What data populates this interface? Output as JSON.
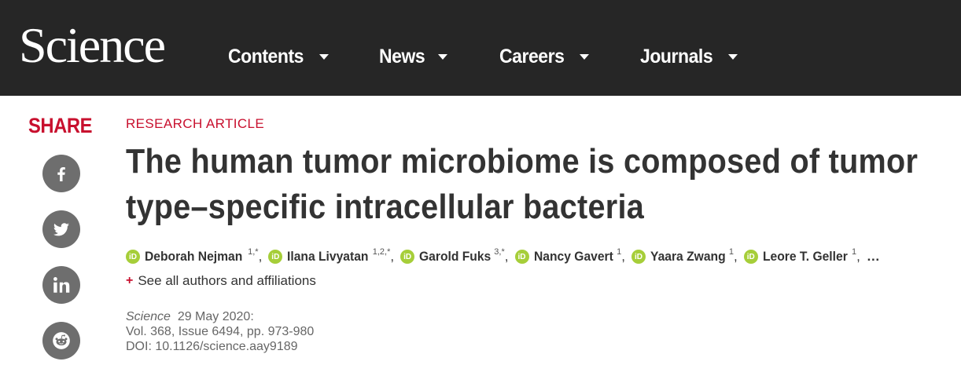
{
  "header": {
    "logo": "Science",
    "nav": [
      {
        "label": "Contents"
      },
      {
        "label": "News"
      },
      {
        "label": "Careers"
      },
      {
        "label": "Journals"
      }
    ],
    "background": "#262626"
  },
  "share": {
    "title": "SHARE",
    "buttons": [
      {
        "icon": "facebook-icon"
      },
      {
        "icon": "twitter-icon"
      },
      {
        "icon": "linkedin-icon"
      },
      {
        "icon": "reddit-icon"
      }
    ]
  },
  "article": {
    "kicker": "RESEARCH ARTICLE",
    "title_line1": "The human tumor microbiome is composed of tumor",
    "title_line2": "type–specific intracellular bacteria",
    "authors": [
      {
        "name": "Deborah Nejman",
        "aff": "1,*"
      },
      {
        "name": "Ilana Livyatan",
        "aff": "1,2,*"
      },
      {
        "name": "Garold Fuks",
        "aff": "3,*"
      },
      {
        "name": "Nancy Gavert",
        "aff": "1"
      },
      {
        "name": "Yaara Zwang",
        "aff": "1"
      },
      {
        "name": "Leore T. Geller",
        "aff": "1"
      }
    ],
    "authors_more": "…",
    "see_all": "See all authors and affiliations",
    "journal": "Science",
    "date": "29 May 2020:",
    "volume": "Vol. 368, Issue 6494, pp. 973-980",
    "doi": "DOI: 10.1126/science.aay9189"
  },
  "colors": {
    "accent": "#c8102e",
    "orcid": "#a6ce39",
    "icon_bg": "#6e6e6e"
  }
}
